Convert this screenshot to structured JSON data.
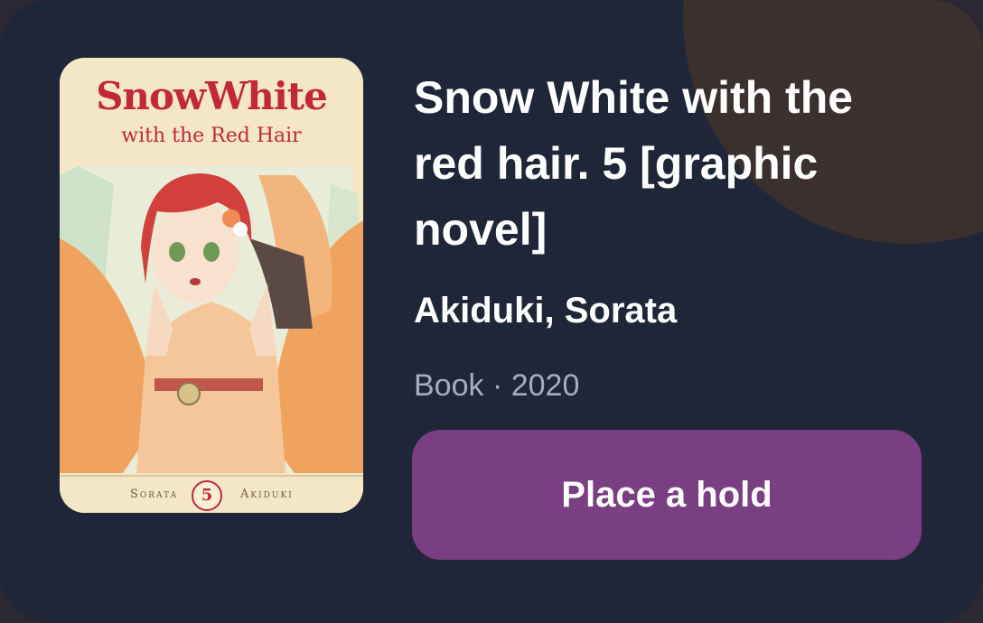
{
  "item": {
    "title": "Snow White with the red hair. 5 [graphic novel]",
    "author": "Akiduki, Sorata",
    "meta": "Book · 2020"
  },
  "cover": {
    "title": "SnowWhite",
    "subtitle": "with the Red Hair",
    "author_first": "Sorata",
    "volume": "5",
    "author_last": "Akiduki"
  },
  "actions": {
    "hold_label": "Place a hold"
  },
  "colors": {
    "card_background": "#1e2637",
    "button_background": "#7a3f82",
    "accent_blob": "#3a302e",
    "meta_text": "#a3adc4"
  }
}
